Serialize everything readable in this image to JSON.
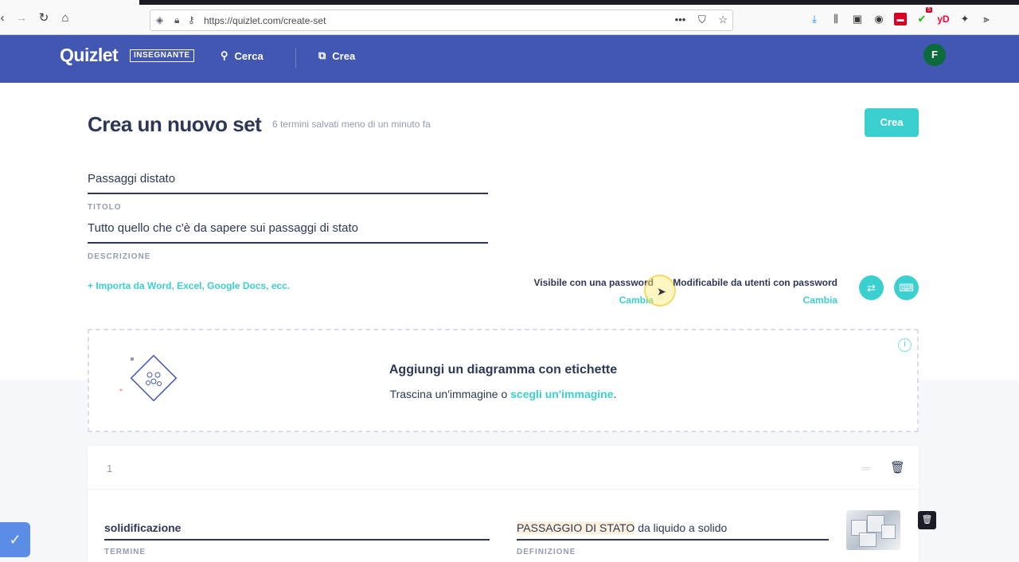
{
  "browser": {
    "url": "https://quizlet.com/create-set",
    "notification_badge": "5"
  },
  "header": {
    "logo": "Quizlet",
    "badge": "INSEGNANTE",
    "nav_search": "Cerca",
    "nav_create": "Crea",
    "avatar_letter": "F"
  },
  "page": {
    "title": "Crea un nuovo set",
    "saved_note": "6 termini salvati meno di un minuto fa",
    "create_button": "Crea"
  },
  "fields": {
    "title_value": "Passaggi distato",
    "title_label": "TITOLO",
    "description_value": "Tutto quello che c'è da sapere sui passaggi di stato",
    "description_label": "DESCRIZIONE"
  },
  "import_link": "+ Importa da Word, Excel, Google Docs, ecc.",
  "permissions": {
    "visible": {
      "text": "Visibile con una password",
      "change": "Cambia"
    },
    "editable": {
      "text": "Modificabile da utenti con password",
      "change": "Cambia"
    }
  },
  "diagram": {
    "title": "Aggiungi un diagramma con etichette",
    "subtitle_prefix": "Trascina un'immagine o ",
    "subtitle_link": "scegli un'immagine",
    "subtitle_suffix": "."
  },
  "card": {
    "number": "1",
    "term": "solidificazione",
    "term_label": "TERMINE",
    "definition_highlight": "PASSAGGIO DI STATO",
    "definition_rest": " da liquido a solido",
    "definition_label": "DEFINIZIONE"
  },
  "colors": {
    "header_blue": "#4257b2",
    "accent_teal": "#3ccfcf",
    "text_dark": "#2e3856",
    "text_muted": "#939bb4"
  }
}
